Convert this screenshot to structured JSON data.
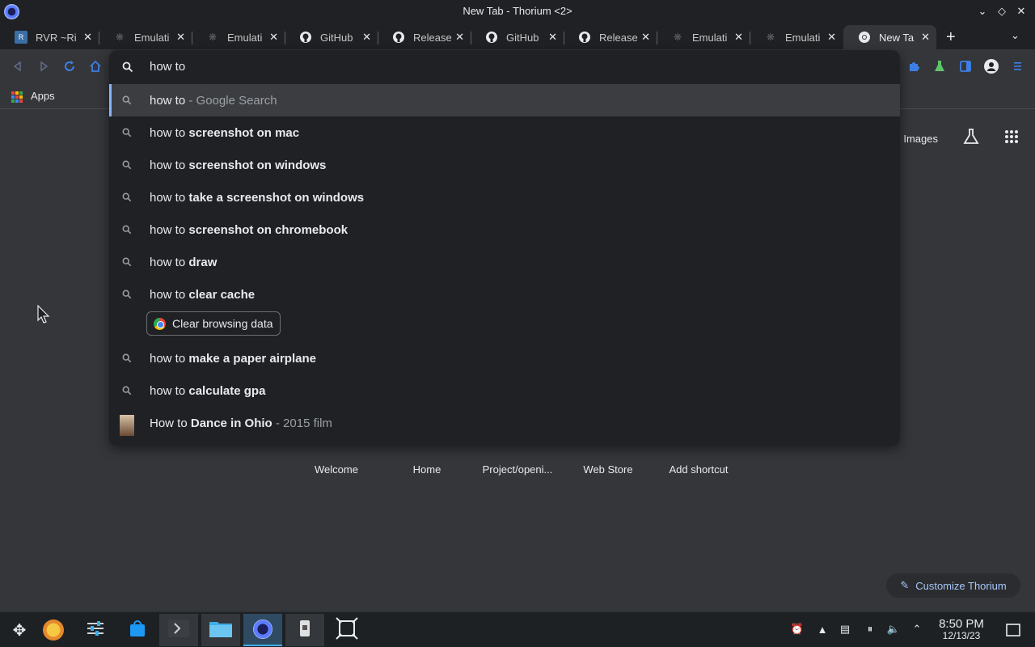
{
  "window": {
    "title": "New Tab - Thorium <2>"
  },
  "tabs": [
    {
      "label": "RVR ~Ri",
      "favicon": "rvr-icon"
    },
    {
      "label": "Emulati",
      "favicon": "emulation-icon"
    },
    {
      "label": "Emulati",
      "favicon": "emulation-icon"
    },
    {
      "label": "GitHub",
      "favicon": "github-icon"
    },
    {
      "label": "Release",
      "favicon": "github-icon"
    },
    {
      "label": "GitHub",
      "favicon": "github-icon"
    },
    {
      "label": "Release",
      "favicon": "github-icon"
    },
    {
      "label": "Emulati",
      "favicon": "emulation-icon"
    },
    {
      "label": "Emulati",
      "favicon": "emulation-icon"
    },
    {
      "label": "New Ta",
      "favicon": "chrome-icon",
      "active": true
    }
  ],
  "bookmarks": {
    "apps_label": "Apps"
  },
  "omnibox": {
    "input": "how to",
    "suggestions": [
      {
        "prefix": "how to",
        "bold": "",
        "suffix": " - Google Search",
        "selected": true
      },
      {
        "prefix": "how to ",
        "bold": "screenshot on mac",
        "suffix": ""
      },
      {
        "prefix": "how to ",
        "bold": "screenshot on windows",
        "suffix": ""
      },
      {
        "prefix": "how to ",
        "bold": "take a screenshot on windows",
        "suffix": ""
      },
      {
        "prefix": "how to ",
        "bold": "screenshot on chromebook",
        "suffix": ""
      },
      {
        "prefix": "how to ",
        "bold": "draw",
        "suffix": ""
      },
      {
        "prefix": "how to ",
        "bold": "clear cache",
        "suffix": ""
      },
      {
        "prefix": "how to ",
        "bold": "make a paper airplane",
        "suffix": ""
      },
      {
        "prefix": "how to ",
        "bold": "calculate gpa",
        "suffix": ""
      },
      {
        "prefix": "How to ",
        "bold": "Dance in Ohio",
        "suffix": " - 2015 film"
      }
    ],
    "action_chip": "Clear browsing data"
  },
  "page": {
    "images_link": "Images",
    "shortcuts": [
      "Welcome",
      "Home",
      "Project/openi...",
      "Web Store",
      "Add shortcut"
    ],
    "customize_label": "Customize Thorium"
  },
  "taskbar": {
    "time": "8:50 PM",
    "date": "12/13/23"
  },
  "colors": {
    "accent": "#8ab4f8",
    "taskbar_active": "#3daee9",
    "chip_text": "#a8c7fa"
  }
}
